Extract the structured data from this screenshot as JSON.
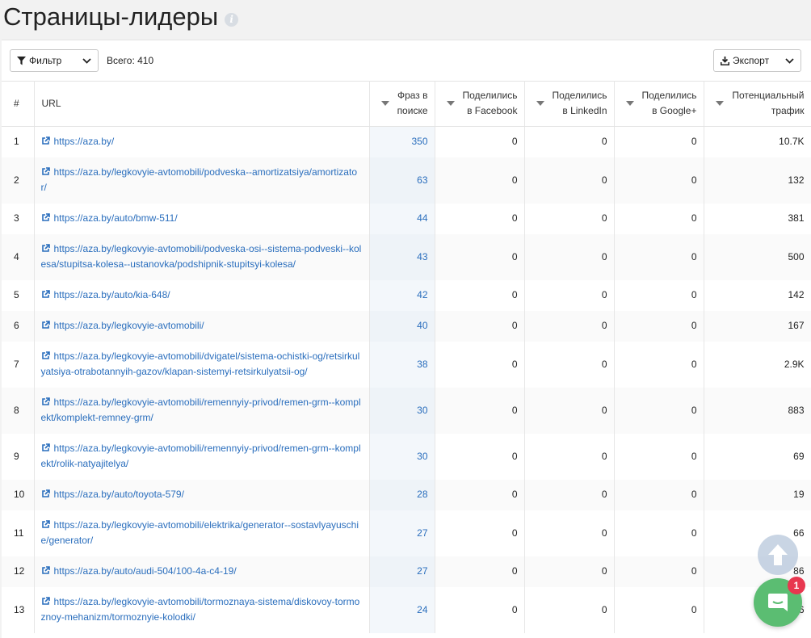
{
  "page": {
    "title": "Страницы-лидеры"
  },
  "toolbar": {
    "filter_label": "Фильтр",
    "total_text": "Всего: 410",
    "export_label": "Экспорт"
  },
  "table": {
    "headers": {
      "index": "#",
      "url": "URL",
      "phrases": "Фраз в поиске",
      "facebook": "Поделились в Facebook",
      "linkedin": "Поделились в LinkedIn",
      "google": "Поделились в Google+",
      "traffic": "Потенциальный трафик"
    },
    "rows": [
      {
        "idx": "1",
        "url": "https://aza.by/",
        "phrases": "350",
        "fb": "0",
        "li": "0",
        "gp": "0",
        "traffic": "10.7K"
      },
      {
        "idx": "2",
        "url": "https://aza.by/legkovyie-avtomobili/podveska--amortizatsiya/amortizator/",
        "phrases": "63",
        "fb": "0",
        "li": "0",
        "gp": "0",
        "traffic": "132"
      },
      {
        "idx": "3",
        "url": "https://aza.by/auto/bmw-511/",
        "phrases": "44",
        "fb": "0",
        "li": "0",
        "gp": "0",
        "traffic": "381"
      },
      {
        "idx": "4",
        "url": "https://aza.by/legkovyie-avtomobili/podveska-osi--sistema-podveski--kolesa/stupitsa-kolesa--ustanovka/podshipnik-stupitsyi-kolesa/",
        "phrases": "43",
        "fb": "0",
        "li": "0",
        "gp": "0",
        "traffic": "500"
      },
      {
        "idx": "5",
        "url": "https://aza.by/auto/kia-648/",
        "phrases": "42",
        "fb": "0",
        "li": "0",
        "gp": "0",
        "traffic": "142"
      },
      {
        "idx": "6",
        "url": "https://aza.by/legkovyie-avtomobili/",
        "phrases": "40",
        "fb": "0",
        "li": "0",
        "gp": "0",
        "traffic": "167"
      },
      {
        "idx": "7",
        "url": "https://aza.by/legkovyie-avtomobili/dvigatel/sistema-ochistki-og/retsirkulyatsiya-otrabotannyih-gazov/klapan-sistemyi-retsirkulyatsii-og/",
        "phrases": "38",
        "fb": "0",
        "li": "0",
        "gp": "0",
        "traffic": "2.9K"
      },
      {
        "idx": "8",
        "url": "https://aza.by/legkovyie-avtomobili/remennyiy-privod/remen-grm--komplekt/komplekt-remney-grm/",
        "phrases": "30",
        "fb": "0",
        "li": "0",
        "gp": "0",
        "traffic": "883"
      },
      {
        "idx": "9",
        "url": "https://aza.by/legkovyie-avtomobili/remennyiy-privod/remen-grm--komplekt/rolik-natyajitelya/",
        "phrases": "30",
        "fb": "0",
        "li": "0",
        "gp": "0",
        "traffic": "69"
      },
      {
        "idx": "10",
        "url": "https://aza.by/auto/toyota-579/",
        "phrases": "28",
        "fb": "0",
        "li": "0",
        "gp": "0",
        "traffic": "19"
      },
      {
        "idx": "11",
        "url": "https://aza.by/legkovyie-avtomobili/elektrika/generator--sostavlyayuschie/generator/",
        "phrases": "27",
        "fb": "0",
        "li": "0",
        "gp": "0",
        "traffic": "66"
      },
      {
        "idx": "12",
        "url": "https://aza.by/auto/audi-504/100-4a-c4-19/",
        "phrases": "27",
        "fb": "0",
        "li": "0",
        "gp": "0",
        "traffic": "86"
      },
      {
        "idx": "13",
        "url": "https://aza.by/legkovyie-avtomobili/tormoznaya-sistema/diskovoy-tormoznoy-mehanizm/tormoznyie-kolodki/",
        "phrases": "24",
        "fb": "0",
        "li": "0",
        "gp": "0",
        "traffic": "6"
      }
    ]
  },
  "chat": {
    "badge_count": "1"
  },
  "colors": {
    "link": "#2a6ebd",
    "chat": "#5bbd72",
    "badge": "#e8374f"
  }
}
